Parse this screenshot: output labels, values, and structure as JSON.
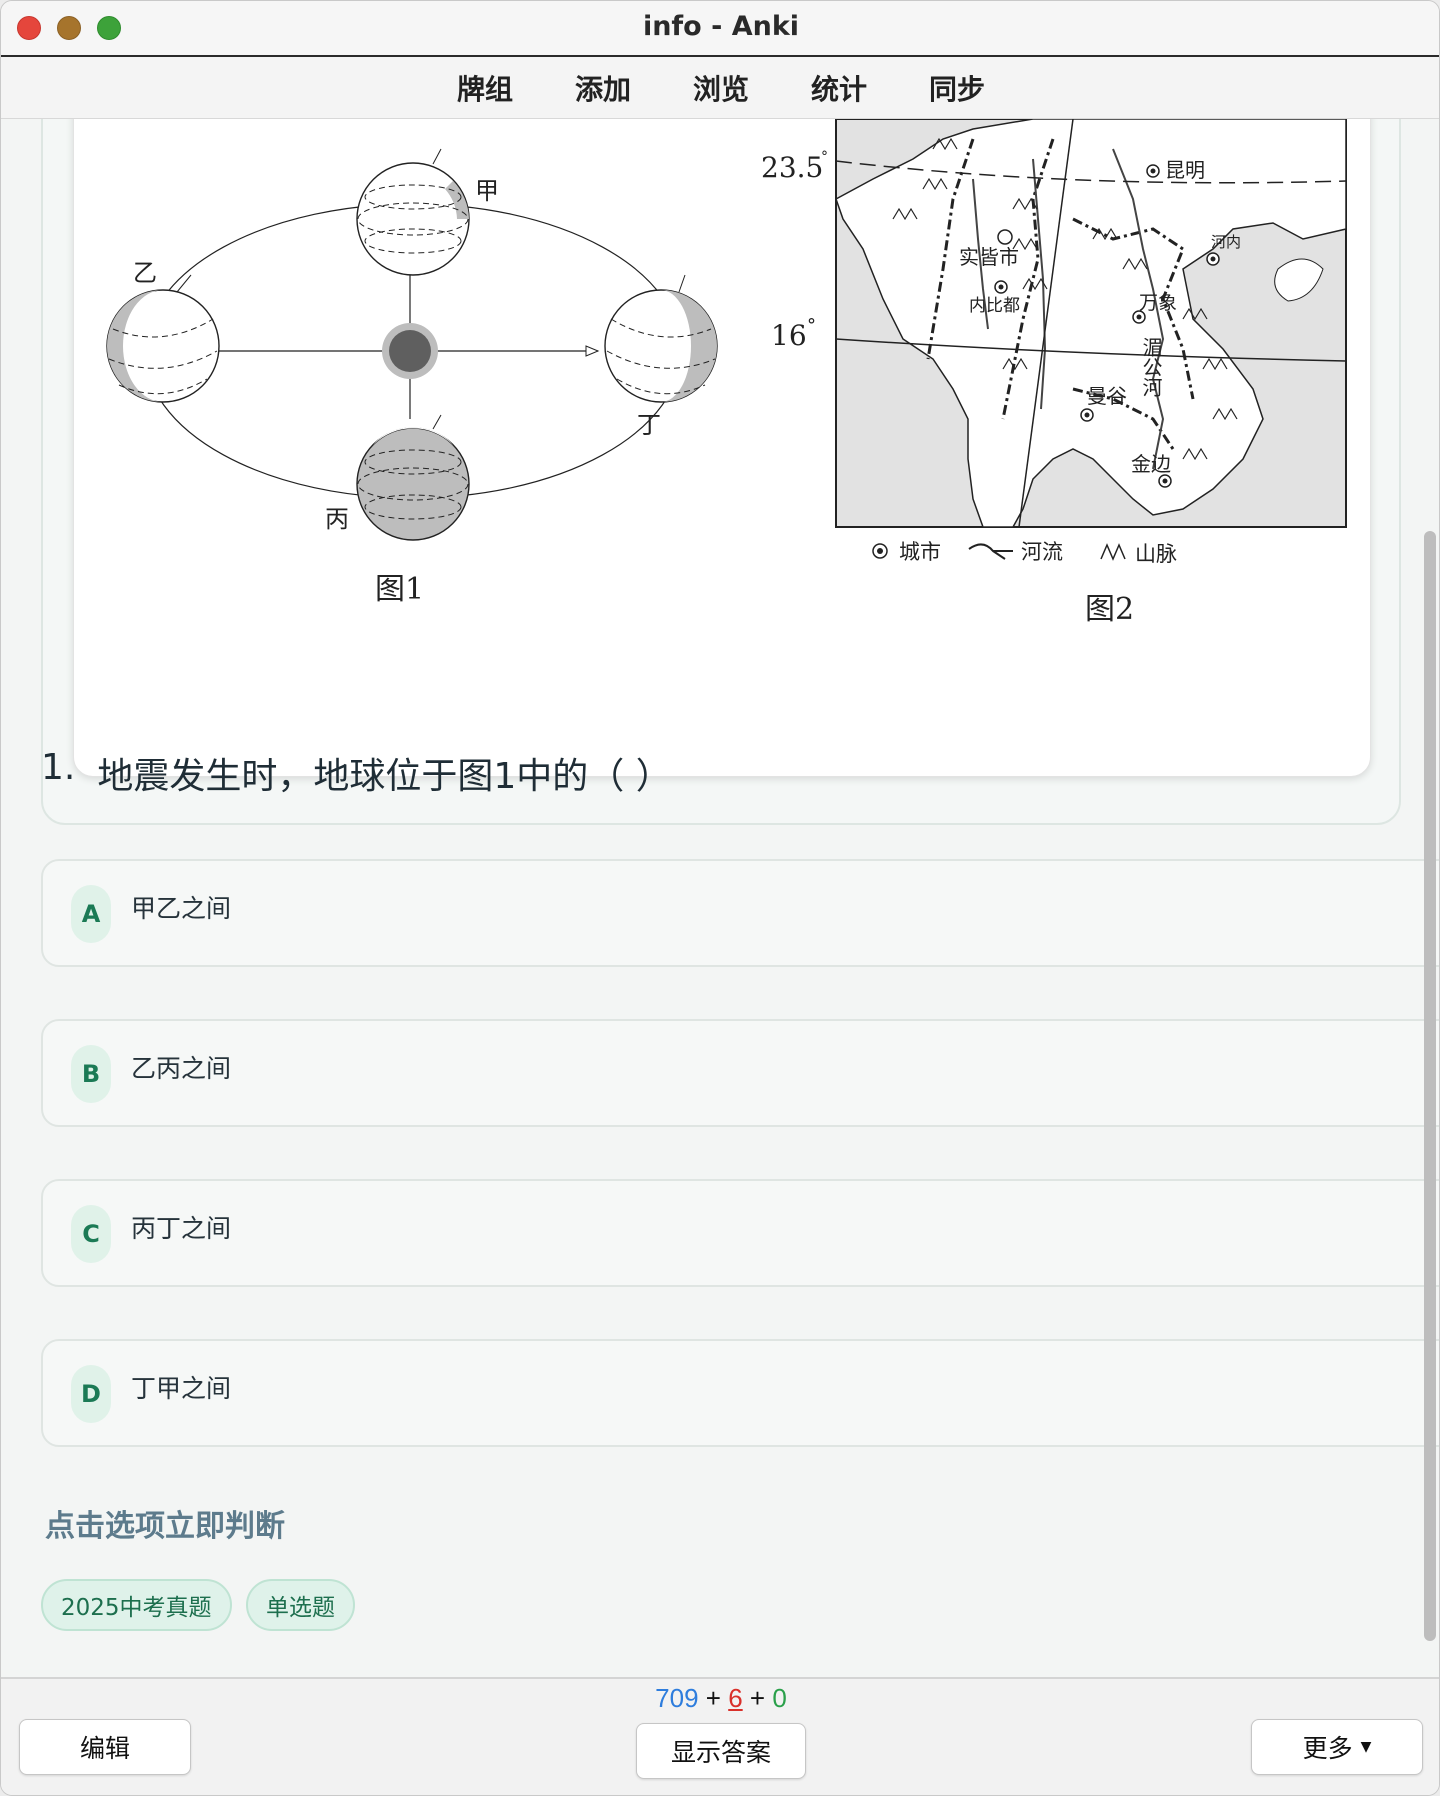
{
  "window": {
    "title": "info - Anki"
  },
  "toolbar": {
    "items": [
      "牌组",
      "添加",
      "浏览",
      "统计",
      "同步"
    ]
  },
  "figure1": {
    "caption": "图1",
    "labels": {
      "jia": "甲",
      "yi": "乙",
      "bing": "丙",
      "ding": "丁"
    }
  },
  "figure2": {
    "caption": "图2",
    "lat_upper": "23.5",
    "lat_lower": "16",
    "cities": {
      "kunming": "昆明",
      "hanoi": "河内",
      "shijie": "实皆市",
      "neibidu": "内比都",
      "wanxiang": "万象",
      "mangu": "曼谷",
      "jinbian": "金边",
      "meigonghe": "湄公河"
    },
    "legend": {
      "city": "城市",
      "river": "河流",
      "mountain": "山脉"
    }
  },
  "question": {
    "number": "1.",
    "text": "地震发生时，地球位于图1中的（ ）"
  },
  "options": [
    {
      "letter": "A",
      "text": "甲乙之间"
    },
    {
      "letter": "B",
      "text": "乙丙之间"
    },
    {
      "letter": "C",
      "text": "丙丁之间"
    },
    {
      "letter": "D",
      "text": "丁甲之间"
    }
  ],
  "hint": "点击选项立即判断",
  "tags": [
    "2025中考真题",
    "单选题"
  ],
  "footer": {
    "count_new": "709",
    "count_learn": "6",
    "count_review": "0",
    "plus": "+",
    "edit_label": "编辑",
    "show_answer_label": "显示答案",
    "more_label": "更多"
  }
}
